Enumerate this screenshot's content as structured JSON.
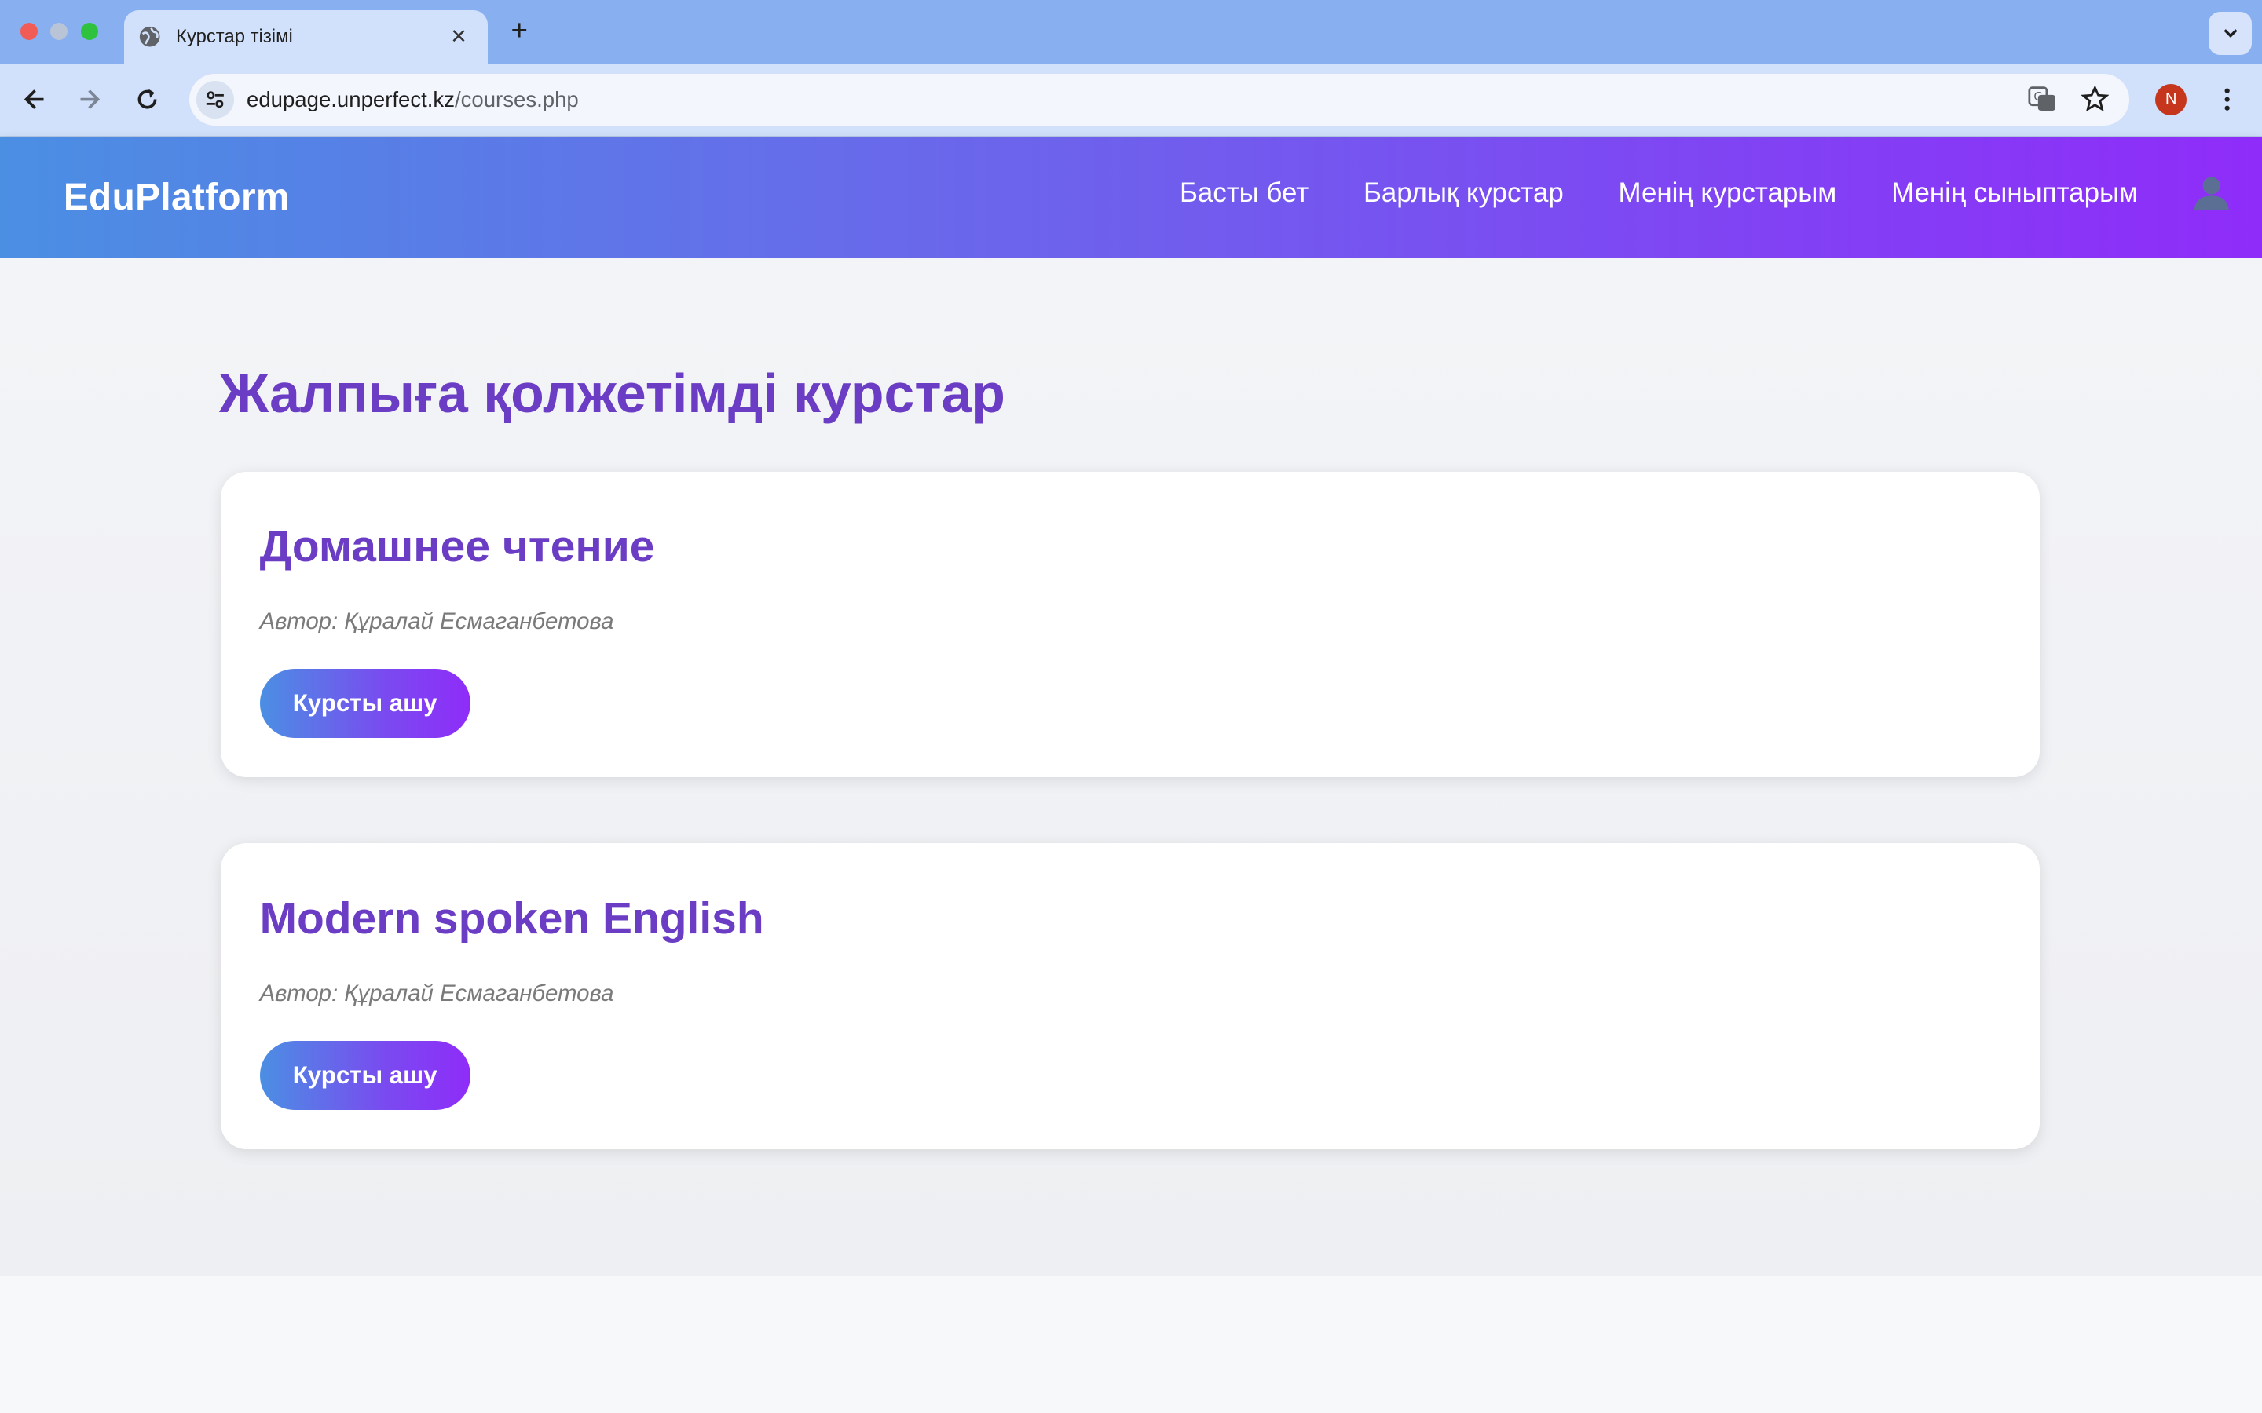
{
  "browser": {
    "tab_title": "Курстар тізімі",
    "url_domain": "edupage.unperfect.kz",
    "url_path": "/courses.php",
    "profile_initial": "N"
  },
  "site": {
    "brand": "EduPlatform",
    "nav": [
      {
        "label": "Басты бет"
      },
      {
        "label": "Барлық курстар"
      },
      {
        "label": "Менің курстарым"
      },
      {
        "label": "Менің сыныптарым"
      }
    ]
  },
  "page": {
    "title": "Жалпыға қолжетімді курстар",
    "courses": [
      {
        "title": "Домашнее чтение",
        "author": "Автор: Құралай Есмаганбетова",
        "button": "Курсты ашу"
      },
      {
        "title": "Modern spoken English",
        "author": "Автор: Құралай Есмаганбетова",
        "button": "Курсты ашу"
      }
    ]
  },
  "colors": {
    "accent": "#6a3dc4",
    "gradient_start": "#4b8fe3",
    "gradient_end": "#8f2cf9"
  }
}
